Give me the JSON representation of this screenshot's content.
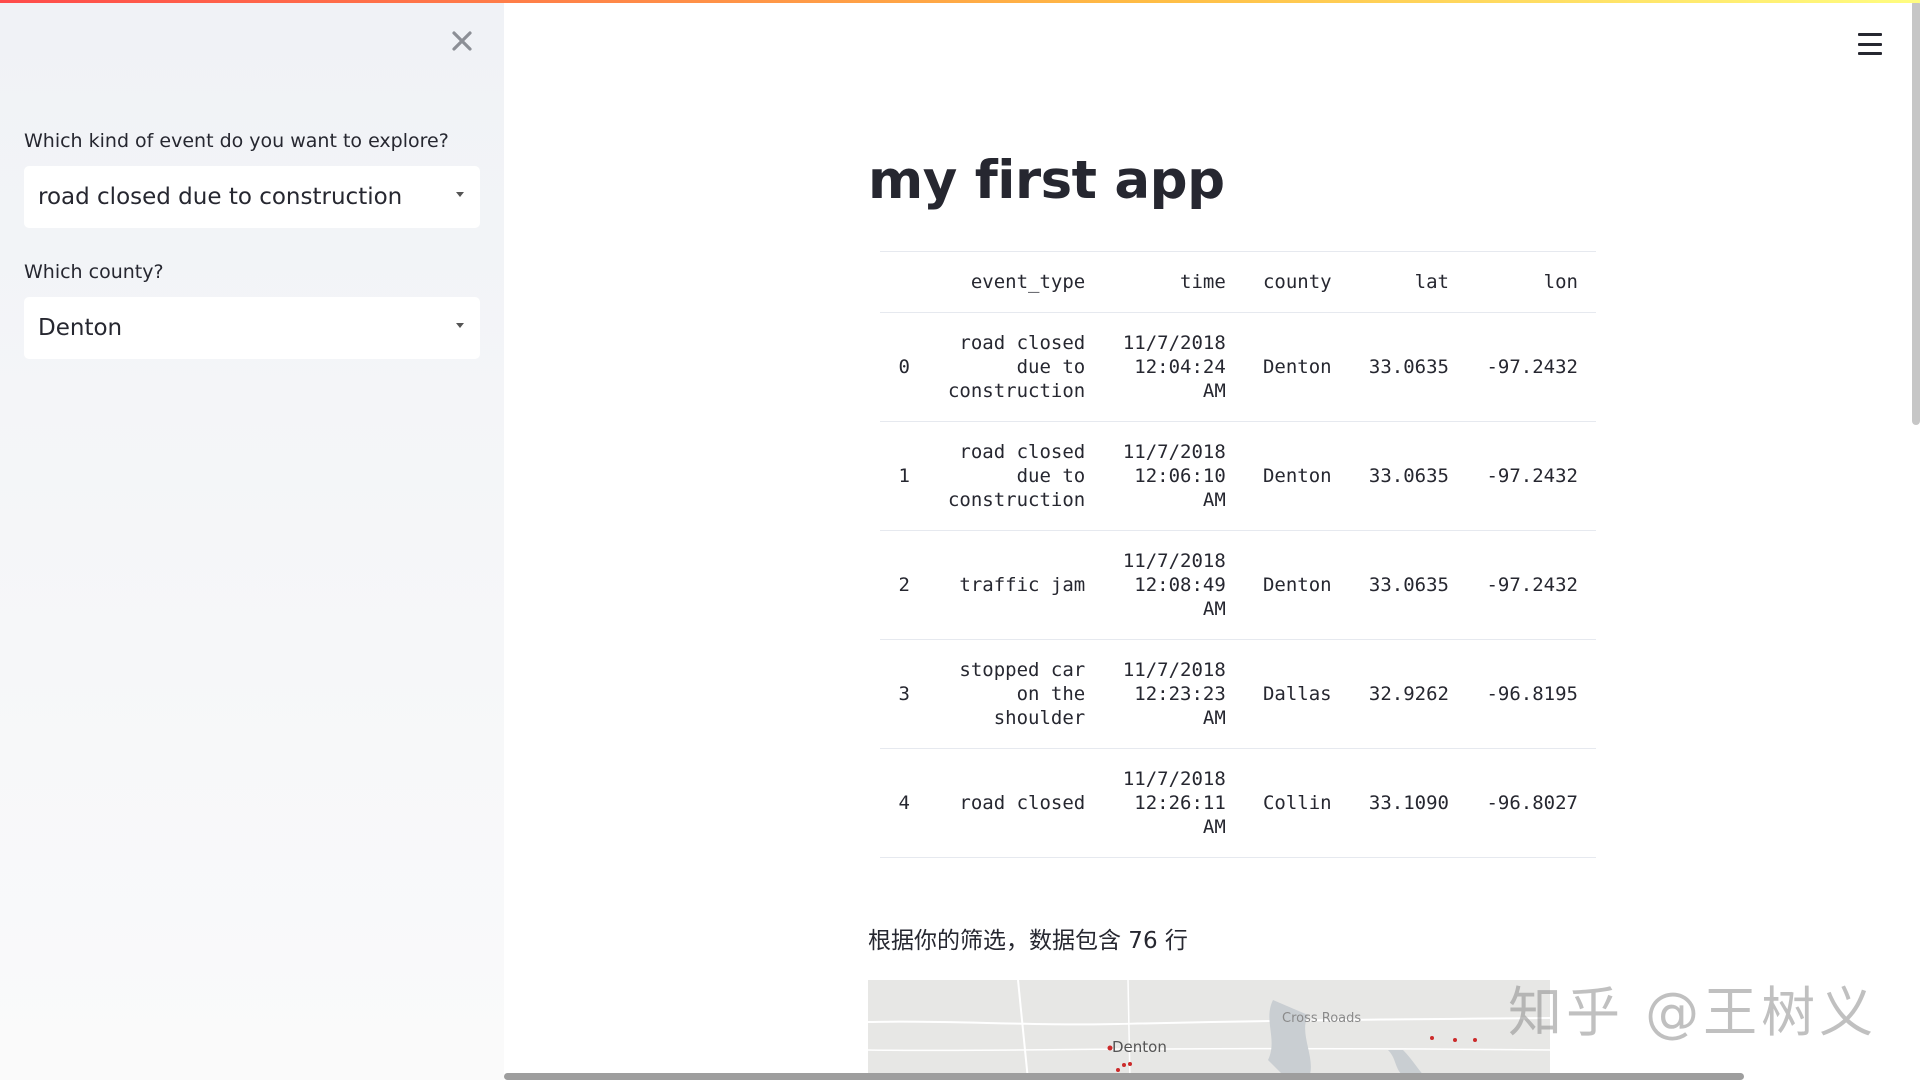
{
  "sidebar": {
    "event_label": "Which kind of event do you want to explore?",
    "event_value": "road closed due to construction",
    "county_label": "Which county?",
    "county_value": "Denton"
  },
  "main": {
    "title": "my first app",
    "summary": "根据你的筛选，数据包含 76 行",
    "table": {
      "columns": [
        "",
        "event_type",
        "time",
        "county",
        "lat",
        "lon"
      ],
      "rows": [
        [
          "0",
          "road closed\ndue to\nconstruction",
          "11/7/2018\n12:04:24\nAM",
          "Denton",
          "33.0635",
          "-97.2432"
        ],
        [
          "1",
          "road closed\ndue to\nconstruction",
          "11/7/2018\n12:06:10\nAM",
          "Denton",
          "33.0635",
          "-97.2432"
        ],
        [
          "2",
          "traffic jam",
          "11/7/2018\n12:08:49\nAM",
          "Denton",
          "33.0635",
          "-97.2432"
        ],
        [
          "3",
          "stopped car\non the\nshoulder",
          "11/7/2018\n12:23:23\nAM",
          "Dallas",
          "32.9262",
          "-96.8195"
        ],
        [
          "4",
          "road closed",
          "11/7/2018\n12:26:11\nAM",
          "Collin",
          "33.1090",
          "-96.8027"
        ]
      ]
    },
    "map": {
      "labels": [
        "Denton",
        "Cross Roads"
      ]
    }
  },
  "watermark": "知乎 @王树义",
  "icons": {
    "close": "close-icon",
    "menu": "hamburger-menu-icon",
    "dropdown": "chevron-down-icon"
  },
  "colors": {
    "accent_gradient_start": "#ff4b4b",
    "accent_gradient_end": "#fffd80",
    "sidebar_bg": "#f0f2f6",
    "map_point": "#cc2b2b"
  }
}
